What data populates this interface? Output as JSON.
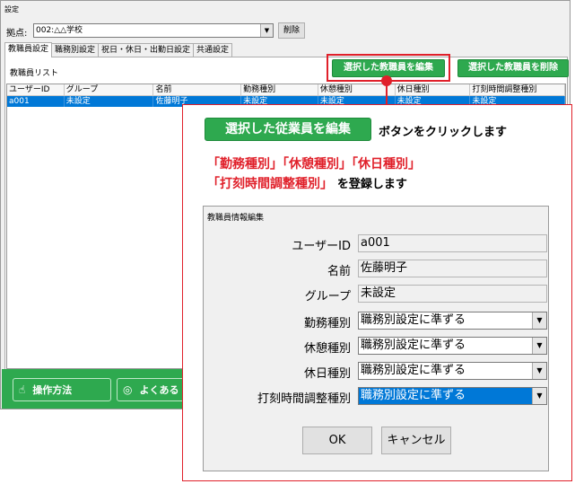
{
  "window": {
    "title": "設定",
    "base_label": "拠点:",
    "base_value": "002:△△学校",
    "delete_button": "削除",
    "tabs": [
      "教職員設定",
      "職務別設定",
      "祝日・休日・出勤日設定",
      "共通設定"
    ],
    "list_label": "教職員リスト",
    "edit_button": "選択した教職員を編集",
    "remove_button": "選択した教職員を削除",
    "columns": [
      "ユーザーID",
      "グループ",
      "名前",
      "勤務種別",
      "休憩種別",
      "休日種別",
      "打刻時間調整種別"
    ],
    "rows": [
      [
        "a001",
        "未設定",
        "佐藤明子",
        "未設定",
        "未設定",
        "未設定",
        "未設定"
      ]
    ],
    "bottom_buttons": [
      {
        "icon": "hand-pointer-icon",
        "label": "操作方法"
      },
      {
        "icon": "chat-icon",
        "label": "よくある"
      }
    ]
  },
  "callout": {
    "button_label": "選択した従業員を編集",
    "line1_suffix": "ボタンをクリックします",
    "red_line1": "「勤務種別」「休憩種別」「休日種別」",
    "red_line2": "「打刻時間調整種別」",
    "line2_suffix": "を登録します"
  },
  "dialog": {
    "title": "教職員情報編集",
    "fields": [
      {
        "label": "ユーザーID",
        "value": "a001"
      },
      {
        "label": "名前",
        "value": "佐藤明子"
      },
      {
        "label": "グループ",
        "value": "未設定"
      }
    ],
    "selects": [
      {
        "label": "勤務種別",
        "value": "職務別設定に準ずる"
      },
      {
        "label": "休憩種別",
        "value": "職務別設定に準ずる"
      },
      {
        "label": "休日種別",
        "value": "職務別設定に準ずる"
      },
      {
        "label": "打刻時間調整種別",
        "value": "職務別設定に準ずる"
      }
    ],
    "ok_label": "OK",
    "cancel_label": "キャンセル"
  },
  "colors": {
    "accent_green": "#2ea94f",
    "highlight_red": "#e0202a",
    "selection_blue": "#0078d7"
  }
}
